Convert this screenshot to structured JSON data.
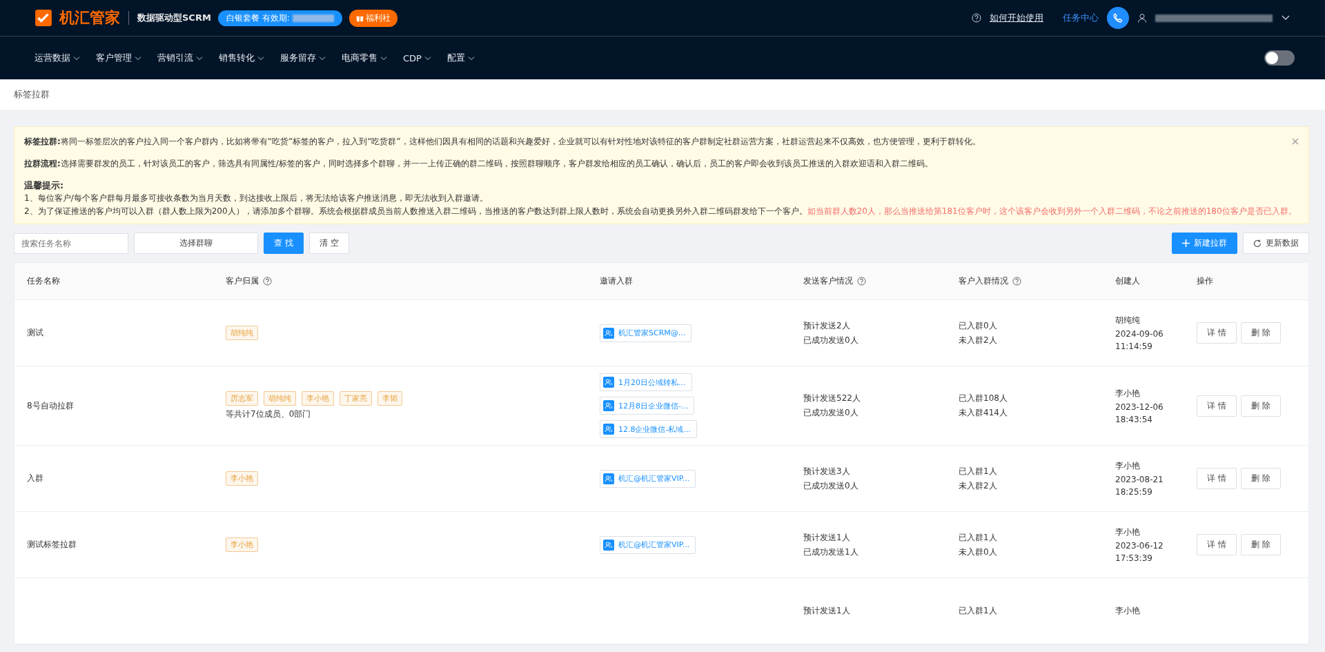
{
  "header": {
    "logo_text": "机汇管家",
    "subtitle": "数据驱动型SCRM",
    "plan_badge": "白银套餐 有效期:",
    "welfare_badge": "福利社",
    "help_link": "如何开始使用",
    "task_center": "任务中心"
  },
  "nav": {
    "items": [
      {
        "label": "运营数据"
      },
      {
        "label": "客户管理"
      },
      {
        "label": "营销引流"
      },
      {
        "label": "销售转化"
      },
      {
        "label": "服务留存"
      },
      {
        "label": "电商零售"
      },
      {
        "label": "CDP"
      },
      {
        "label": "配置"
      }
    ],
    "toggle": {
      "on": false
    }
  },
  "breadcrumb": "标签拉群",
  "notice": {
    "paragraphs": [
      {
        "label": "标签拉群:",
        "text": "将同一标签层次的客户拉入同一个客户群内，比如将带有“吃货”标签的客户，拉入到“吃货群”，这样他们因具有相同的话题和兴趣爱好，企业就可以有针对性地对该特征的客户群制定社群运营方案，社群运营起来不仅高效，也方便管理，更利于群转化。"
      },
      {
        "label": "拉群流程:",
        "text": "选择需要群发的员工，针对该员工的客户，筛选具有同属性/标签的客户，同时选择多个群聊，并一一上传正确的群二维码，按照群聊顺序，客户群发给相应的员工确认，确认后，员工的客户即会收到该员工推送的入群欢迎语和入群二维码。"
      }
    ],
    "tips_title": "温馨提示:",
    "tips": [
      {
        "text": "1、每位客户/每个客户群每月最多可接收条数为当月天数，到达接收上限后，将无法给该客户推送消息，即无法收到入群邀请。"
      },
      {
        "text": "2、为了保证推送的客户均可以入群（群人数上限为200人），请添加多个群聊。系统会根据群成员当前人数推送入群二维码，当推送的客户数达到群上限人数时，系统会自动更换另外入群二维码群发给下一个客户。",
        "highlight": "如当前群人数20人，那么当推送给第181位客户时，这个该客户会收到另外一个入群二维码，不论之前推送的180位客户是否已入群。"
      }
    ]
  },
  "toolbar": {
    "search_placeholder": "搜索任务名称",
    "group_select": "选择群聊",
    "search_button": "查 找",
    "clear_button": "清 空",
    "new_button": "新建拉群",
    "refresh_button": "更新数据"
  },
  "table": {
    "columns": [
      {
        "label": "任务名称",
        "help": false
      },
      {
        "label": "客户归属",
        "help": true
      },
      {
        "label": "邀请入群",
        "help": false
      },
      {
        "label": "发送客户情况",
        "help": true
      },
      {
        "label": "客户入群情况",
        "help": true
      },
      {
        "label": "创建人",
        "help": false
      },
      {
        "label": "操作",
        "help": false
      }
    ],
    "rows": [
      {
        "name": "测试",
        "tags": [
          "胡纯纯"
        ],
        "groups": [
          "机汇管家SCRM@..."
        ],
        "send": [
          "预计发送2人",
          "已成功发送0人"
        ],
        "join": [
          "已入群0人",
          "未入群2人"
        ],
        "creator": [
          "胡纯纯",
          "2024-09-06",
          "11:14:59"
        ],
        "actions": [
          "详 情",
          "删 除"
        ]
      },
      {
        "name": "8号自动拉群",
        "tags": [
          "厉志军",
          "胡纯纯",
          "李小艳",
          "丁家亮",
          "李韬"
        ],
        "summary": "等共计7位成员、0部门",
        "groups": [
          "1月20日公域转私...",
          "12月8日企业微信-...",
          "12.8企业微信-私域..."
        ],
        "send": [
          "预计发送522人",
          "已成功发送0人"
        ],
        "join": [
          "已入群108人",
          "未入群414人"
        ],
        "creator": [
          "李小艳",
          "2023-12-06",
          "18:43:54"
        ],
        "actions": [
          "详 情",
          "删 除"
        ]
      },
      {
        "name": "入群",
        "tags": [
          "李小艳"
        ],
        "groups": [
          "机汇@机汇管家VIP..."
        ],
        "send": [
          "预计发送3人",
          "已成功发送0人"
        ],
        "join": [
          "已入群1人",
          "未入群2人"
        ],
        "creator": [
          "李小艳",
          "2023-08-21",
          "18:25:59"
        ],
        "actions": [
          "详 情",
          "删 除"
        ]
      },
      {
        "name": "测试标签拉群",
        "tags": [
          "李小艳"
        ],
        "groups": [
          "机汇@机汇管家VIP..."
        ],
        "send": [
          "预计发送1人",
          "已成功发送1人"
        ],
        "join": [
          "已入群1人",
          "未入群0人"
        ],
        "creator": [
          "李小艳",
          "2023-06-12",
          "17:53:39"
        ],
        "actions": [
          "详 情",
          "删 除"
        ]
      },
      {
        "send": [
          "预计发送1人"
        ],
        "join": [
          "已入群1人"
        ],
        "creator": [
          "李小艳"
        ]
      }
    ]
  }
}
